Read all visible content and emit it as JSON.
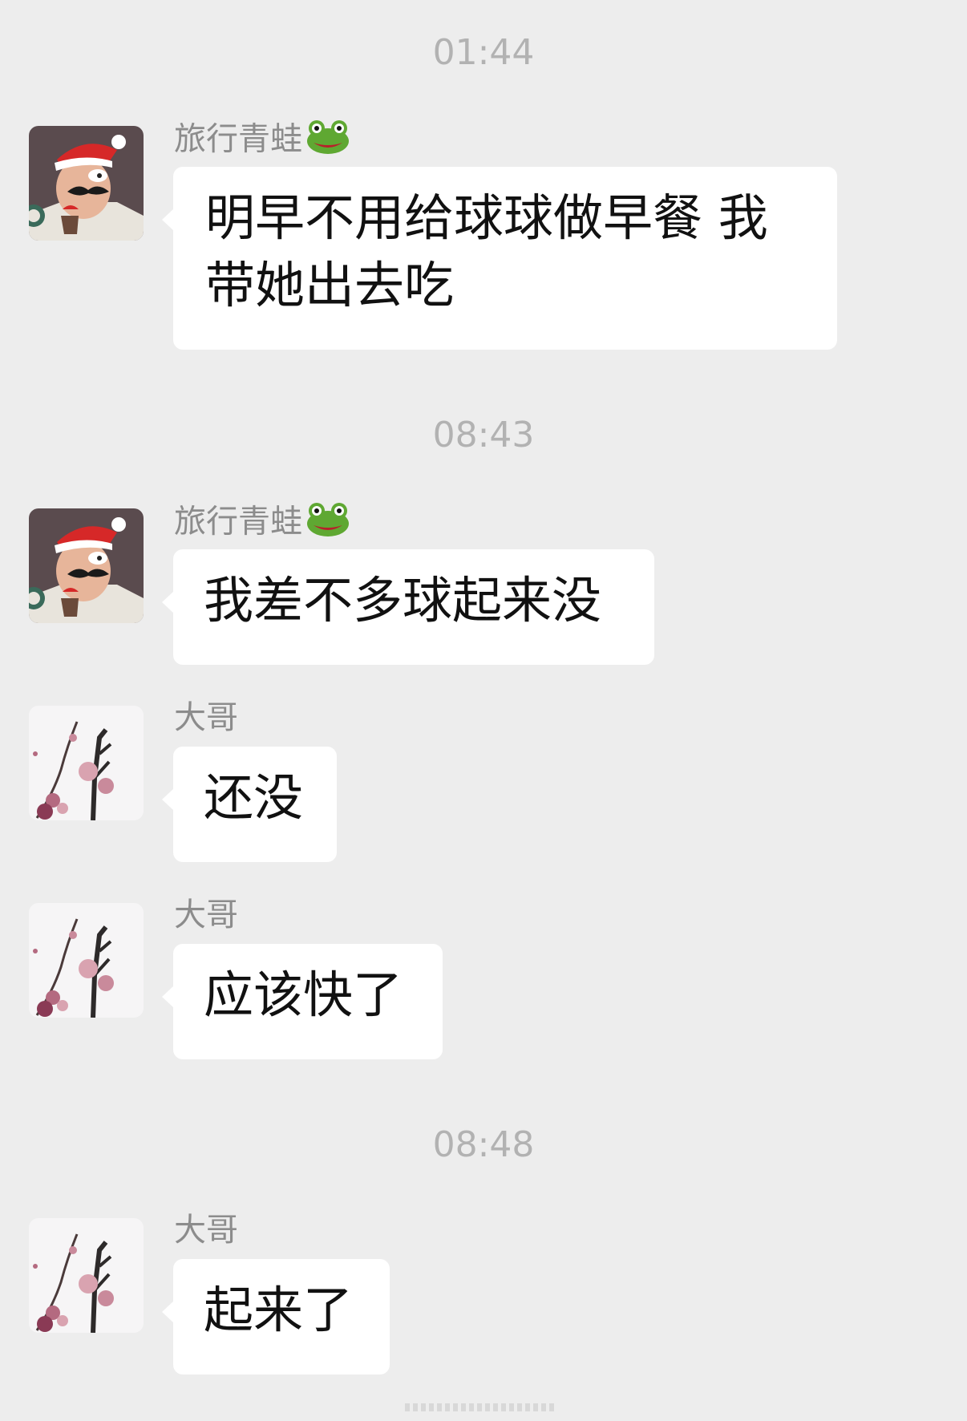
{
  "chat": {
    "timestamps": [
      "01:44",
      "08:43",
      "08:48"
    ],
    "messages": [
      {
        "sender": "旅行青蛙",
        "sender_emoji": "frog-icon",
        "avatar": "cartoon-man-santa-hat",
        "text": "明早不用给球球做早餐 我带她出去吃"
      },
      {
        "sender": "旅行青蛙",
        "sender_emoji": "frog-icon",
        "avatar": "cartoon-man-santa-hat",
        "text": "我差不多球起来没"
      },
      {
        "sender": "大哥",
        "avatar": "plum-blossom-branch",
        "text": "还没"
      },
      {
        "sender": "大哥",
        "avatar": "plum-blossom-branch",
        "text": "应该快了"
      },
      {
        "sender": "大哥",
        "avatar": "plum-blossom-branch",
        "text": "起来了"
      }
    ]
  },
  "colors": {
    "background": "#ededed",
    "bubble": "#ffffff",
    "timestamp": "#b2b2b2",
    "sender_name": "#8c8c8c"
  }
}
